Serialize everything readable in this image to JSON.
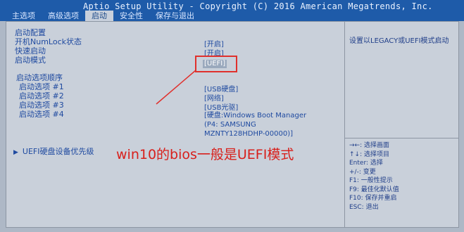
{
  "header": {
    "title": "Aptio Setup Utility - Copyright (C) 2016 American Megatrends, Inc.",
    "tabs": [
      {
        "label": "主选项",
        "active": false
      },
      {
        "label": "高级选项",
        "active": false
      },
      {
        "label": "启动",
        "active": true
      },
      {
        "label": "安全性",
        "active": false
      },
      {
        "label": "保存与退出",
        "active": false
      }
    ]
  },
  "main": {
    "section_title": "启动配置",
    "settings": [
      {
        "label": "开机NumLock状态",
        "value": "[开启]"
      },
      {
        "label": "快速启动",
        "value": "[开启]"
      },
      {
        "label": "启动模式",
        "value": "[UEFI]",
        "selected": true
      }
    ],
    "boot_order_title": "启动选项顺序",
    "boot_options": [
      {
        "label": "启动选项 #1",
        "value": "[USB硬盘]"
      },
      {
        "label": "启动选项 #2",
        "value": "[网络]"
      },
      {
        "label": "启动选项 #3",
        "value": "[USB光驱]"
      },
      {
        "label": "启动选项 #4",
        "value_lines": [
          "[硬盘:Windows Boot Manager",
          "(P4: SAMSUNG",
          "MZNTY128HDHP-00000)]"
        ]
      }
    ],
    "submenu_label": "UEFI硬盘设备优先级"
  },
  "help": {
    "text": "设置以LEGACY或UEFI模式启动"
  },
  "keys": [
    "→←: 选择画面",
    "↑↓: 选择项目",
    "Enter: 选择",
    "+/-: 变更",
    "F1: 一般性提示",
    "F9: 最佳化默认值",
    "F10: 保存并重启",
    "ESC: 退出"
  ],
  "annotation": {
    "text": "win10的bios一般是UEFI模式"
  },
  "colors": {
    "title_bar": "#1e5ba9",
    "panel": "#c9d0da",
    "text": "#1f4aa0",
    "annotation": "#d8201c"
  }
}
